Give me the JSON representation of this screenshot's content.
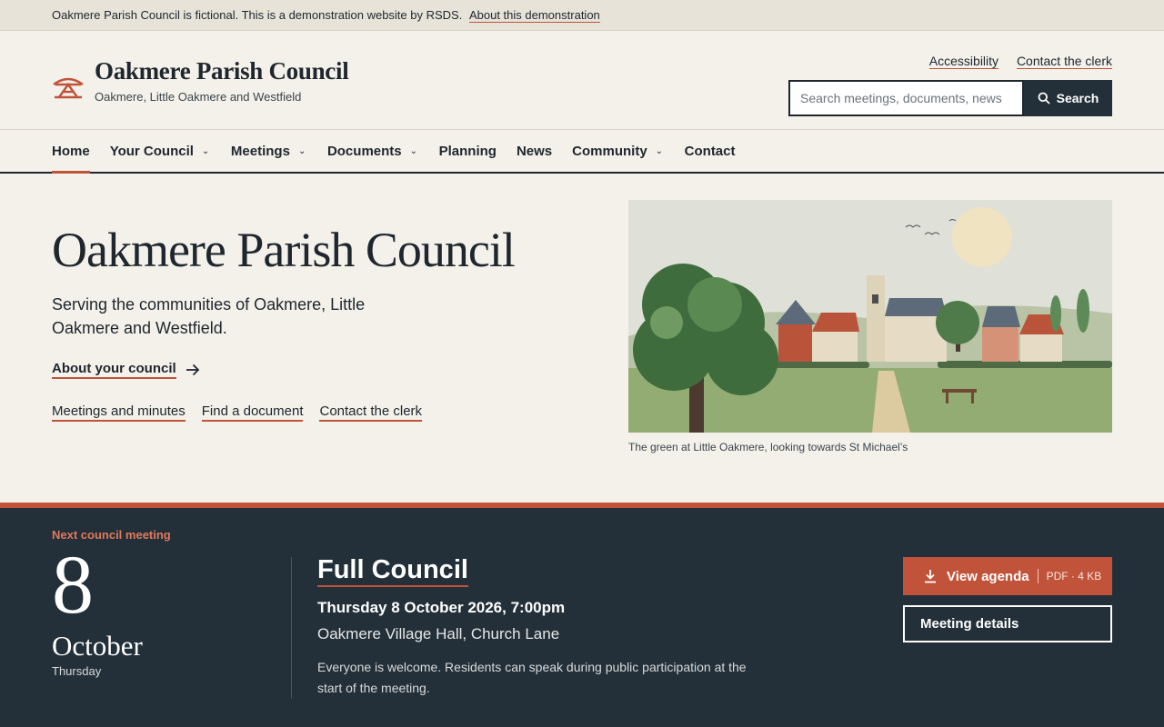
{
  "demo_bar": {
    "text": "Oakmere Parish Council is fictional. This is a demonstration website by RSDS.",
    "link": "About this demonstration"
  },
  "header": {
    "title": "Oakmere Parish Council",
    "subtitle": "Oakmere, Little Oakmere and Westfield",
    "utility_links": [
      "Accessibility",
      "Contact the clerk"
    ],
    "search": {
      "placeholder": "Search meetings, documents, news",
      "button_label": "Search"
    }
  },
  "nav": {
    "items": [
      {
        "label": "Home",
        "dropdown": false,
        "active": true
      },
      {
        "label": "Your Council",
        "dropdown": true,
        "active": false
      },
      {
        "label": "Meetings",
        "dropdown": true,
        "active": false
      },
      {
        "label": "Documents",
        "dropdown": true,
        "active": false
      },
      {
        "label": "Planning",
        "dropdown": false,
        "active": false
      },
      {
        "label": "News",
        "dropdown": false,
        "active": false
      },
      {
        "label": "Community",
        "dropdown": true,
        "active": false
      },
      {
        "label": "Contact",
        "dropdown": false,
        "active": false
      }
    ]
  },
  "hero": {
    "title": "Oakmere Parish Council",
    "text": "Serving the communities of Oakmere, Little Oakmere and Westfield.",
    "cta": "About your council",
    "links": [
      "Meetings and minutes",
      "Find a document",
      "Contact the clerk"
    ],
    "caption": "The green at Little Oakmere, looking towards St Michael’s"
  },
  "meeting": {
    "label": "Next council meeting",
    "day": "8",
    "month": "October",
    "weekday": "Thursday",
    "title": "Full Council",
    "datetime": "Thursday 8 October 2026, 7:00pm",
    "venue": "Oakmere Village Hall, Church Lane",
    "description": "Everyone is welcome. Residents can speak during public participation at the start of the meeting.",
    "agenda_button": "View agenda",
    "agenda_meta": "PDF · 4 KB",
    "details_button": "Meeting details"
  },
  "colors": {
    "accent": "#c0533a",
    "dark": "#233039",
    "background": "#f3f1ea"
  }
}
